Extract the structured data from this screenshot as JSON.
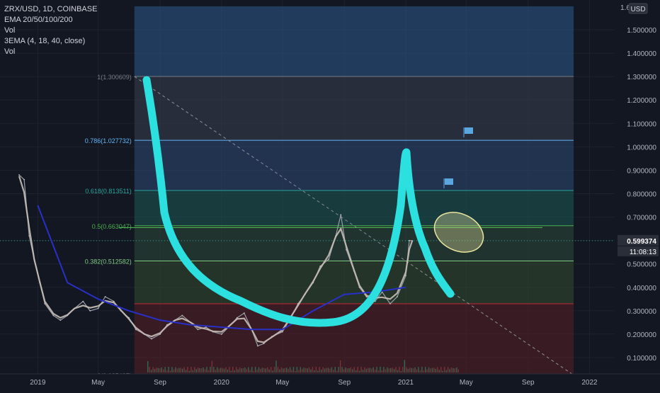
{
  "legend": {
    "symbol": "ZRX/USD, 1D, COINBASE",
    "ema": "EMA 20/50/100/200",
    "vol1": "Vol",
    "ema3": "3EMA (4, 18, 40, close)",
    "vol2": "Vol"
  },
  "currency": "USD",
  "top_tick_partial": "1.6",
  "current_price": "0.599374",
  "countdown": "11:08:13",
  "colors": {
    "background": "#131722",
    "grid": "#1e222d",
    "axis_text": "#b2b5be",
    "price_line": "#26a69a",
    "price_label_bg": "#2a2e39",
    "price_label_text": "#ffffff",
    "drawn_line": "#2de0e0",
    "ema_blue": "#2830c8",
    "ema_white": "#c9bfb8",
    "ellipse": "#e8e6a0",
    "fib_level_1": "#787b86",
    "fib_level_786": "#64b5f6",
    "fib_level_618": "#26a69a",
    "fib_level_5": "#4caf50",
    "fib_level_382": "#81c784",
    "fib_zone_red": "#b22833",
    "flag": "#5aa6e0"
  },
  "chart_data": {
    "type": "line",
    "title": "ZRX/USD, 1D, COINBASE",
    "xlabel": "",
    "ylabel": "",
    "x_ticks": [
      "2019",
      "May",
      "Sep",
      "2020",
      "May",
      "Sep",
      "2021",
      "May",
      "Sep",
      "2022"
    ],
    "y_ticks": [
      "0.100000",
      "0.200000",
      "0.300000",
      "0.400000",
      "0.500000",
      "0.600000",
      "0.700000",
      "0.800000",
      "0.900000",
      "1.000000",
      "1.100000",
      "1.200000",
      "1.300000",
      "1.400000",
      "1.500000"
    ],
    "ylim": [
      0.05,
      1.6
    ],
    "grid": true,
    "fib_levels": [
      {
        "label": "1(1.300609)",
        "value": 1.300609
      },
      {
        "label": "0.786(1.027732)",
        "value": 1.027732
      },
      {
        "label": "0.618(0.813511)",
        "value": 0.813511
      },
      {
        "label": "0.5(0.663047)",
        "value": 0.663047
      },
      {
        "label": "0.382(0.512582)",
        "value": 0.512582
      },
      {
        "label": "0(0.025437)",
        "value": 0.025437
      }
    ],
    "annotations": {
      "horizontal_line": 0.655,
      "current_price": 0.599374
    },
    "series": [
      {
        "name": "ZRX/USD",
        "x": [
          "2018-11-25",
          "2018-12-05",
          "2018-12-15",
          "2018-12-25",
          "2019-01-05",
          "2019-01-15",
          "2019-02-01",
          "2019-02-15",
          "2019-03-01",
          "2019-03-15",
          "2019-04-01",
          "2019-04-15",
          "2019-05-01",
          "2019-05-15",
          "2019-06-01",
          "2019-06-15",
          "2019-07-01",
          "2019-07-15",
          "2019-08-01",
          "2019-08-15",
          "2019-09-01",
          "2019-09-15",
          "2019-10-01",
          "2019-10-15",
          "2019-11-01",
          "2019-11-15",
          "2019-12-01",
          "2019-12-15",
          "2020-01-01",
          "2020-01-15",
          "2020-02-01",
          "2020-02-15",
          "2020-03-01",
          "2020-03-13",
          "2020-03-25",
          "2020-04-10",
          "2020-05-01",
          "2020-05-15",
          "2020-06-01",
          "2020-06-15",
          "2020-07-01",
          "2020-07-15",
          "2020-08-01",
          "2020-08-15",
          "2020-08-25",
          "2020-09-05",
          "2020-09-20",
          "2020-10-01",
          "2020-10-15",
          "2020-11-01",
          "2020-11-15",
          "2020-12-01",
          "2020-12-15",
          "2021-01-01",
          "2021-01-08",
          "2021-01-14"
        ],
        "values": [
          0.88,
          0.86,
          0.62,
          0.52,
          0.42,
          0.33,
          0.28,
          0.26,
          0.28,
          0.31,
          0.34,
          0.3,
          0.31,
          0.36,
          0.34,
          0.3,
          0.27,
          0.22,
          0.2,
          0.18,
          0.2,
          0.24,
          0.26,
          0.28,
          0.25,
          0.22,
          0.23,
          0.21,
          0.2,
          0.23,
          0.27,
          0.29,
          0.22,
          0.15,
          0.16,
          0.19,
          0.21,
          0.26,
          0.33,
          0.37,
          0.42,
          0.49,
          0.52,
          0.62,
          0.71,
          0.56,
          0.47,
          0.4,
          0.36,
          0.34,
          0.38,
          0.33,
          0.36,
          0.45,
          0.6,
          0.599
        ]
      },
      {
        "name": "",
        "x": [
          "2019-01-01",
          "2019-03-01",
          "2019-05-01",
          "2019-07-01",
          "2019-09-01",
          "2019-11-01",
          "2020-01-01",
          "2020-03-01",
          "2020-05-01",
          "2020-07-01",
          "2020-09-01",
          "2020-11-01",
          "2021-01-01"
        ],
        "values": [
          0.75,
          0.42,
          0.35,
          0.3,
          0.26,
          0.24,
          0.23,
          0.22,
          0.22,
          0.3,
          0.37,
          0.38,
          0.4
        ]
      }
    ]
  }
}
